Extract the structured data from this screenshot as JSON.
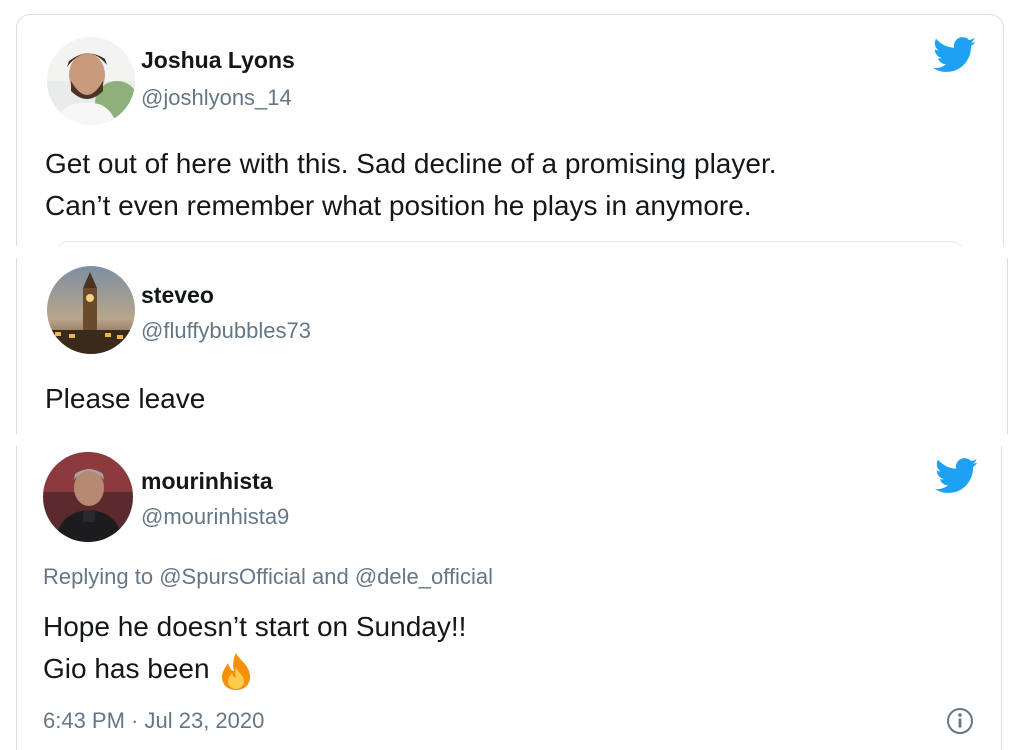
{
  "tweets": [
    {
      "author_name": "Joshua Lyons",
      "author_handle": "@joshlyons_14",
      "text_line1": "Get out of here with this. Sad decline of a promising player.",
      "text_line2": "Can’t even remember what position he plays in anymore.",
      "avatar_icon": "person-photo-avatar",
      "brand_icon": "twitter-bird-icon"
    },
    {
      "author_name": "steveo",
      "author_handle": "@fluffybubbles73",
      "text_line1": "Please leave",
      "avatar_icon": "big-ben-photo-avatar"
    },
    {
      "author_name": "mourinhista",
      "author_handle": "@mourinhista9",
      "replying_prefix": "Replying to",
      "replying_to_1": "@SpursOfficial",
      "replying_and": "and",
      "replying_to_2": "@dele_official",
      "text_line1": "Hope he doesn’t start on Sunday!!",
      "text_line2": "Gio has been",
      "emoji": "fire-emoji",
      "timestamp": "6:43 PM · Jul 23, 2020",
      "avatar_icon": "manager-photo-avatar",
      "brand_icon": "twitter-bird-icon",
      "info_icon": "info-icon"
    }
  ],
  "colors": {
    "twitter_blue": "#1da1f2",
    "text_primary": "#14171a",
    "text_secondary": "#657786",
    "border": "#d9dfe4"
  }
}
